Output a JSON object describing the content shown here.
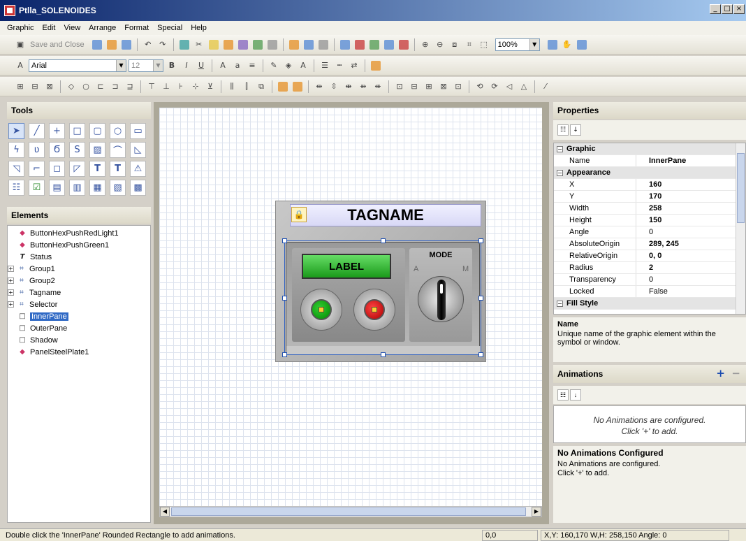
{
  "window": {
    "title": "Ptlla_SOLENOIDES",
    "min": "_",
    "max": "□",
    "close": "×"
  },
  "menu": [
    "Graphic",
    "Edit",
    "View",
    "Arrange",
    "Format",
    "Special",
    "Help"
  ],
  "toolbar": {
    "save_close": "Save and Close",
    "zoom": "100%",
    "font": "Arial",
    "font_size": "12"
  },
  "tools": {
    "title": "Tools"
  },
  "elements": {
    "title": "Elements",
    "items": [
      {
        "label": "ButtonHexPushRedLight1",
        "icon": "symbol-icon"
      },
      {
        "label": "ButtonHexPushGreen1",
        "icon": "symbol-icon"
      },
      {
        "label": "Status",
        "icon": "text-icon"
      },
      {
        "label": "Group1",
        "icon": "group-icon",
        "expandable": true
      },
      {
        "label": "Group2",
        "icon": "group-icon",
        "expandable": true
      },
      {
        "label": "Tagname",
        "icon": "group-icon",
        "expandable": true
      },
      {
        "label": "Selector",
        "icon": "group-icon",
        "expandable": true
      },
      {
        "label": "InnerPane",
        "icon": "rect-icon",
        "selected": true
      },
      {
        "label": "OuterPane",
        "icon": "rect-icon"
      },
      {
        "label": "Shadow",
        "icon": "rect-icon"
      },
      {
        "label": "PanelSteelPlate1",
        "icon": "symbol-icon"
      }
    ]
  },
  "symbol": {
    "header": "TAGNAME",
    "label_button": "LABEL",
    "mode": "MODE",
    "mode_a": "A",
    "mode_m": "M"
  },
  "properties": {
    "title": "Properties",
    "categories": [
      {
        "name": "Graphic",
        "rows": [
          {
            "k": "Name",
            "v": "InnerPane"
          }
        ]
      },
      {
        "name": "Appearance",
        "rows": [
          {
            "k": "X",
            "v": "160"
          },
          {
            "k": "Y",
            "v": "170"
          },
          {
            "k": "Width",
            "v": "258"
          },
          {
            "k": "Height",
            "v": "150"
          },
          {
            "k": "Angle",
            "v": "0"
          },
          {
            "k": "AbsoluteOrigin",
            "v": "289, 245"
          },
          {
            "k": "RelativeOrigin",
            "v": "0, 0"
          },
          {
            "k": "Radius",
            "v": "2"
          },
          {
            "k": "Transparency",
            "v": "0"
          },
          {
            "k": "Locked",
            "v": "False"
          }
        ]
      },
      {
        "name": "Fill Style",
        "rows": []
      }
    ],
    "description_title": "Name",
    "description": "Unique name of the graphic element within the symbol or window."
  },
  "animations": {
    "title": "Animations",
    "add": "+",
    "remove": "−",
    "empty_line1": "No Animations are configured.",
    "empty_line2": "Click '+' to add.",
    "desc_title": "No Animations Configured",
    "desc_line1": "No Animations are configured.",
    "desc_line2": "Click '+' to add."
  },
  "status": {
    "message": "Double click the 'InnerPane' Rounded Rectangle to add animations.",
    "origin": "0,0",
    "coords": "X,Y: 160,170   W,H: 258,150   Angle: 0"
  }
}
